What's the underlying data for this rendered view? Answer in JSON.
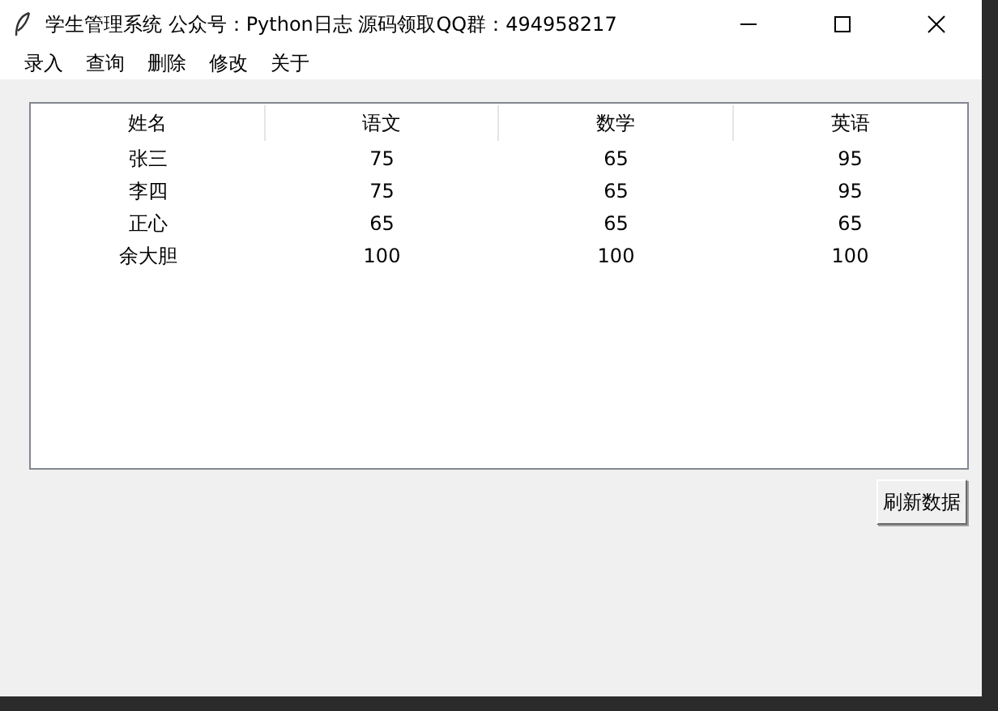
{
  "window": {
    "title": "学生管理系统 公众号：Python日志 源码领取QQ群：494958217"
  },
  "menu": [
    "录入",
    "查询",
    "删除",
    "修改",
    "关于"
  ],
  "table": {
    "columns": [
      "姓名",
      "语文",
      "数学",
      "英语"
    ],
    "rows": [
      [
        "张三",
        "75",
        "65",
        "95"
      ],
      [
        "李四",
        "75",
        "65",
        "95"
      ],
      [
        "正心",
        "65",
        "65",
        "65"
      ],
      [
        "余大胆",
        "100",
        "100",
        "100"
      ]
    ]
  },
  "buttons": [
    "刷新数据"
  ]
}
